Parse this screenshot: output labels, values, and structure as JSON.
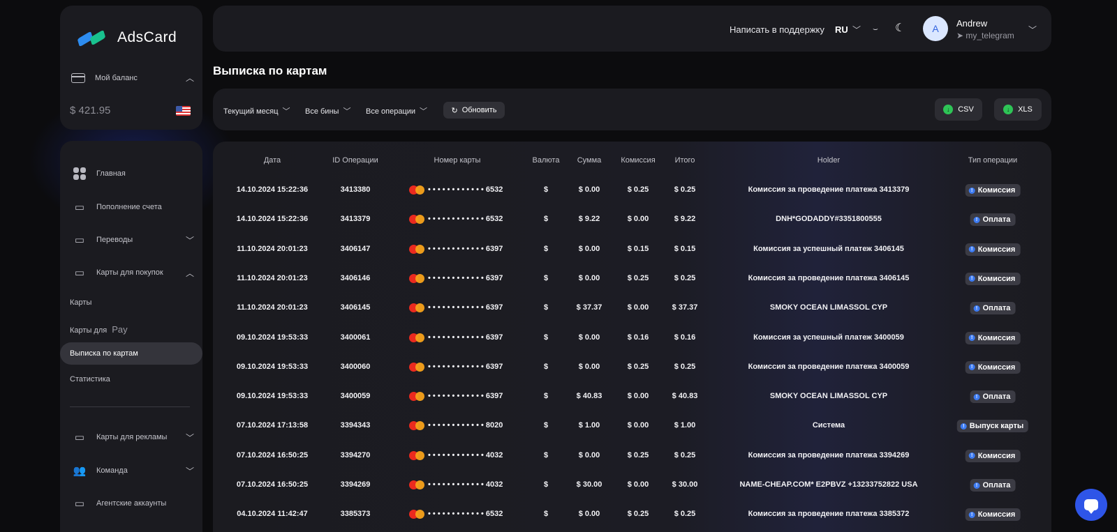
{
  "brand": {
    "name": "AdsCard"
  },
  "balance": {
    "label": "Мой баланс",
    "value": "$ 421.95"
  },
  "sidebar": {
    "items": [
      {
        "label": "Главная"
      },
      {
        "label": "Пополнение счета"
      },
      {
        "label": "Переводы"
      },
      {
        "label": "Карты для покупок"
      }
    ],
    "subitems": [
      {
        "label": "Карты"
      },
      {
        "label": "Карты для",
        "suffix": "Pay"
      },
      {
        "label": "Выписка по картам"
      },
      {
        "label": "Статистика"
      }
    ],
    "bottom_items": [
      {
        "label": "Карты для рекламы"
      },
      {
        "label": "Команда"
      },
      {
        "label": "Агентские аккаунты"
      }
    ]
  },
  "header": {
    "support": "Написать в поддержку",
    "lang": "RU",
    "user": {
      "initial": "A",
      "name": "Andrew",
      "telegram": "my_telegram"
    }
  },
  "page": {
    "title": "Выписка по картам"
  },
  "filters": {
    "period": "Текущий месяц",
    "bins": "Все бины",
    "operations": "Все операции",
    "refresh": "Обновить",
    "csv": "CSV",
    "xls": "XLS"
  },
  "table": {
    "headers": [
      "Дата",
      "ID Операции",
      "Номер карты",
      "Валюта",
      "Сумма",
      "Комиссия",
      "Итого",
      "Holder",
      "Тип операции"
    ],
    "rows": [
      {
        "date": "14.10.2024 15:22:36",
        "id": "3413380",
        "card": "• • • •  • • • •  • • • •  6532",
        "cur": "$",
        "sum": "$ 0.00",
        "fee": "$ 0.25",
        "total": "$ 0.25",
        "holder": "Комиссия за проведение платежа 3413379",
        "type": "Комиссия"
      },
      {
        "date": "14.10.2024 15:22:36",
        "id": "3413379",
        "card": "• • • •  • • • •  • • • •  6532",
        "cur": "$",
        "sum": "$ 9.22",
        "fee": "$ 0.00",
        "total": "$ 9.22",
        "holder": "DNH*GODADDY#3351800555",
        "type": "Оплата"
      },
      {
        "date": "11.10.2024 20:01:23",
        "id": "3406147",
        "card": "• • • •  • • • •  • • • •  6397",
        "cur": "$",
        "sum": "$ 0.00",
        "fee": "$ 0.15",
        "total": "$ 0.15",
        "holder": "Комиссия за успешный платеж 3406145",
        "type": "Комиссия"
      },
      {
        "date": "11.10.2024 20:01:23",
        "id": "3406146",
        "card": "• • • •  • • • •  • • • •  6397",
        "cur": "$",
        "sum": "$ 0.00",
        "fee": "$ 0.25",
        "total": "$ 0.25",
        "holder": "Комиссия за проведение платежа 3406145",
        "type": "Комиссия"
      },
      {
        "date": "11.10.2024 20:01:23",
        "id": "3406145",
        "card": "• • • •  • • • •  • • • •  6397",
        "cur": "$",
        "sum": "$ 37.37",
        "fee": "$ 0.00",
        "total": "$ 37.37",
        "holder": "SMOKY OCEAN LIMASSOL CYP",
        "type": "Оплата"
      },
      {
        "date": "09.10.2024 19:53:33",
        "id": "3400061",
        "card": "• • • •  • • • •  • • • •  6397",
        "cur": "$",
        "sum": "$ 0.00",
        "fee": "$ 0.16",
        "total": "$ 0.16",
        "holder": "Комиссия за успешный платеж 3400059",
        "type": "Комиссия"
      },
      {
        "date": "09.10.2024 19:53:33",
        "id": "3400060",
        "card": "• • • •  • • • •  • • • •  6397",
        "cur": "$",
        "sum": "$ 0.00",
        "fee": "$ 0.25",
        "total": "$ 0.25",
        "holder": "Комиссия за проведение платежа 3400059",
        "type": "Комиссия"
      },
      {
        "date": "09.10.2024 19:53:33",
        "id": "3400059",
        "card": "• • • •  • • • •  • • • •  6397",
        "cur": "$",
        "sum": "$ 40.83",
        "fee": "$ 0.00",
        "total": "$ 40.83",
        "holder": "SMOKY OCEAN LIMASSOL CYP",
        "type": "Оплата"
      },
      {
        "date": "07.10.2024 17:13:58",
        "id": "3394343",
        "card": "• • • •  • • • •  • • • •  8020",
        "cur": "$",
        "sum": "$ 1.00",
        "fee": "$ 0.00",
        "total": "$ 1.00",
        "holder": "Система",
        "type": "Выпуск карты"
      },
      {
        "date": "07.10.2024 16:50:25",
        "id": "3394270",
        "card": "• • • •  • • • •  • • • •  4032",
        "cur": "$",
        "sum": "$ 0.00",
        "fee": "$ 0.25",
        "total": "$ 0.25",
        "holder": "Комиссия за проведение платежа 3394269",
        "type": "Комиссия"
      },
      {
        "date": "07.10.2024 16:50:25",
        "id": "3394269",
        "card": "• • • •  • • • •  • • • •  4032",
        "cur": "$",
        "sum": "$ 30.00",
        "fee": "$ 0.00",
        "total": "$ 30.00",
        "holder": "NAME-CHEAP.COM* E2PBVZ +13233752822 USA",
        "type": "Оплата"
      },
      {
        "date": "04.10.2024 11:42:47",
        "id": "3385373",
        "card": "• • • •  • • • •  • • • •  6532",
        "cur": "$",
        "sum": "$ 0.00",
        "fee": "$ 0.25",
        "total": "$ 0.25",
        "holder": "Комиссия за проведение платежа 3385372",
        "type": "Комиссия"
      }
    ]
  }
}
